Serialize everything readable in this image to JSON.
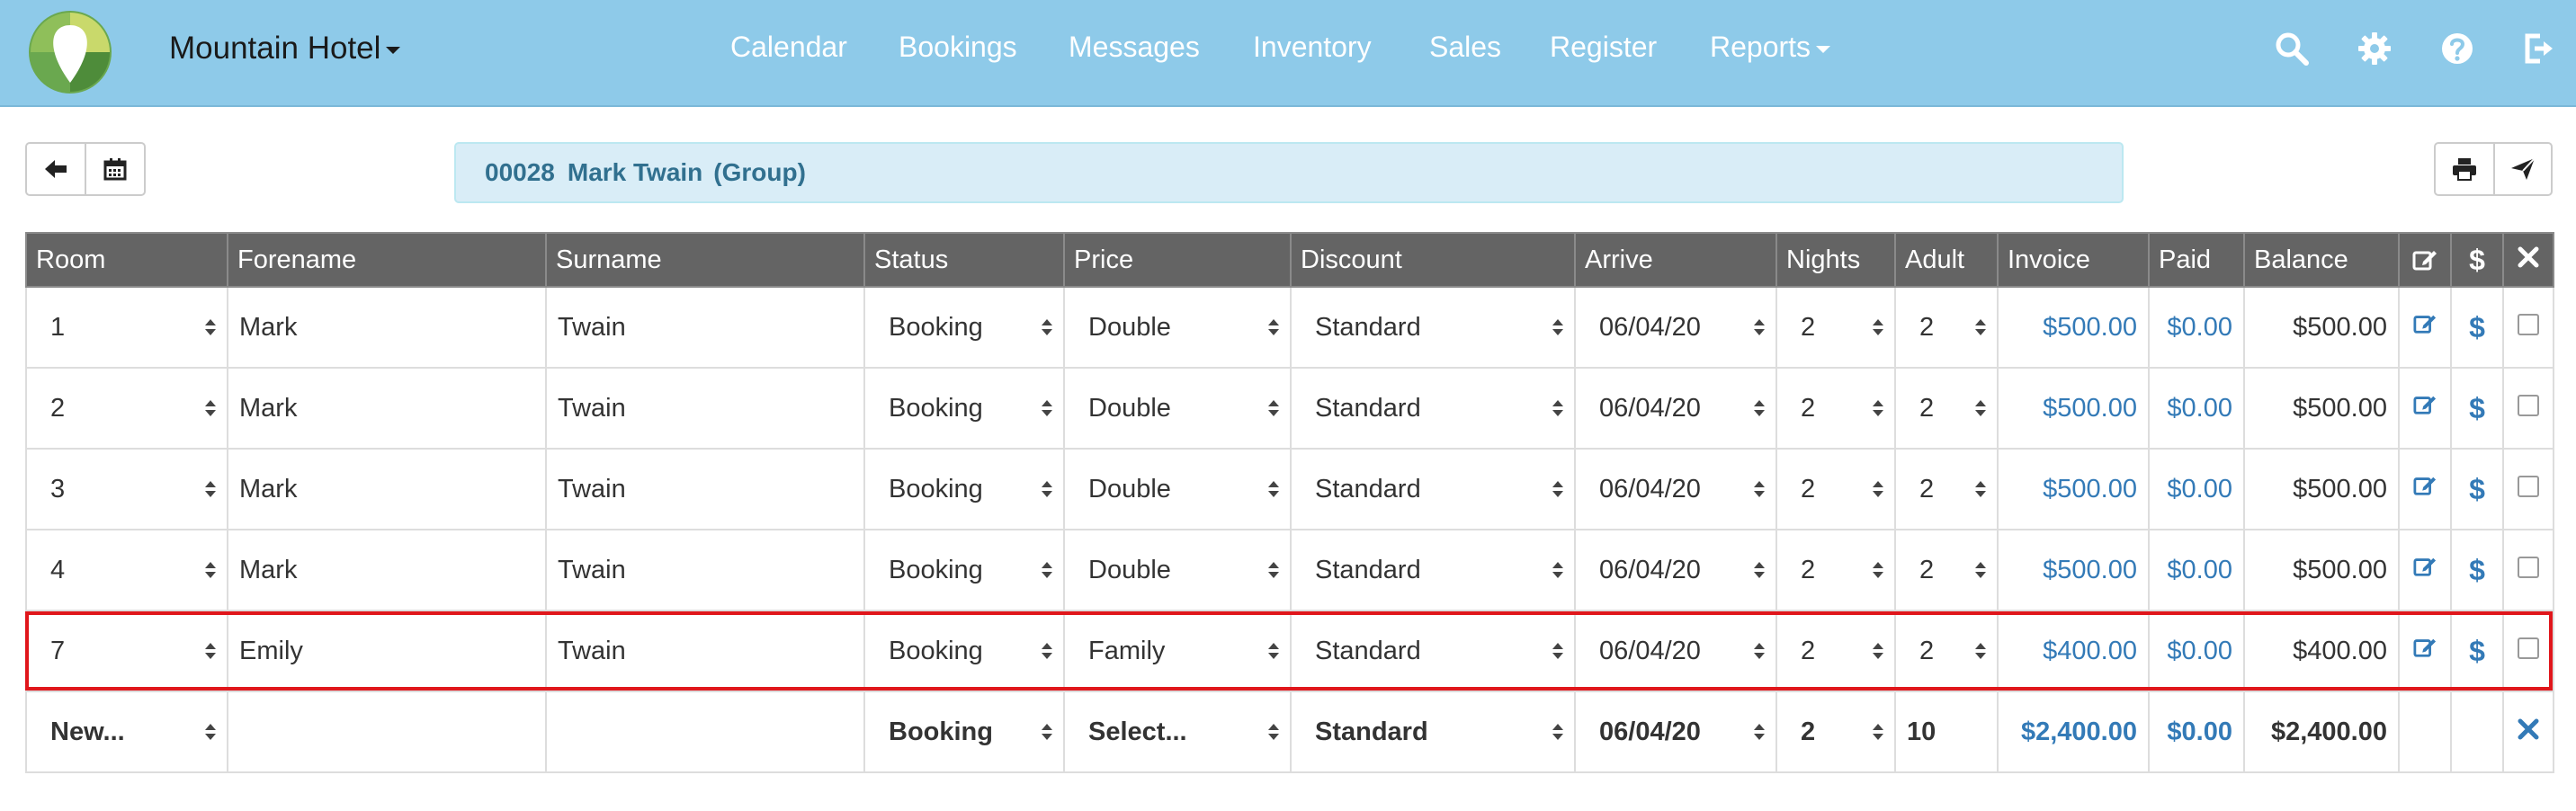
{
  "navbar": {
    "brand": "Mountain Hotel",
    "links": [
      "Calendar",
      "Bookings",
      "Messages",
      "Inventory",
      "Sales",
      "Register",
      "Reports"
    ],
    "icons": [
      "search-icon",
      "gear-icon",
      "help-icon",
      "logout-icon"
    ],
    "background": "#8ecae9"
  },
  "toolbar": {
    "group_number": "00028",
    "group_name": "Mark Twain",
    "group_tag": "(Group)"
  },
  "table": {
    "columns": [
      "Room",
      "Forename",
      "Surname",
      "Status",
      "Price",
      "Discount",
      "Arrive",
      "Nights",
      "Adult",
      "Invoice",
      "Paid",
      "Balance"
    ],
    "rows": [
      {
        "room": "1",
        "forename": "Mark",
        "surname": "Twain",
        "status": "Booking",
        "price": "Double",
        "discount": "Standard",
        "arrive": "06/04/20",
        "nights": "2",
        "adult": "2",
        "invoice": "$500.00",
        "paid": "$0.00",
        "balance": "$500.00"
      },
      {
        "room": "2",
        "forename": "Mark",
        "surname": "Twain",
        "status": "Booking",
        "price": "Double",
        "discount": "Standard",
        "arrive": "06/04/20",
        "nights": "2",
        "adult": "2",
        "invoice": "$500.00",
        "paid": "$0.00",
        "balance": "$500.00"
      },
      {
        "room": "3",
        "forename": "Mark",
        "surname": "Twain",
        "status": "Booking",
        "price": "Double",
        "discount": "Standard",
        "arrive": "06/04/20",
        "nights": "2",
        "adult": "2",
        "invoice": "$500.00",
        "paid": "$0.00",
        "balance": "$500.00"
      },
      {
        "room": "4",
        "forename": "Mark",
        "surname": "Twain",
        "status": "Booking",
        "price": "Double",
        "discount": "Standard",
        "arrive": "06/04/20",
        "nights": "2",
        "adult": "2",
        "invoice": "$500.00",
        "paid": "$0.00",
        "balance": "$500.00"
      },
      {
        "room": "7",
        "forename": "Emily",
        "surname": "Twain",
        "status": "Booking",
        "price": "Family",
        "discount": "Standard",
        "arrive": "06/04/20",
        "nights": "2",
        "adult": "2",
        "invoice": "$400.00",
        "paid": "$0.00",
        "balance": "$400.00"
      }
    ],
    "footer": {
      "room": "New...",
      "status": "Booking",
      "price": "Select...",
      "discount": "Standard",
      "arrive": "06/04/20",
      "nights": "2",
      "adult": "10",
      "invoice": "$2,400.00",
      "paid": "$0.00",
      "balance": "$2,400.00"
    },
    "highlight_color": "#e0161b"
  }
}
